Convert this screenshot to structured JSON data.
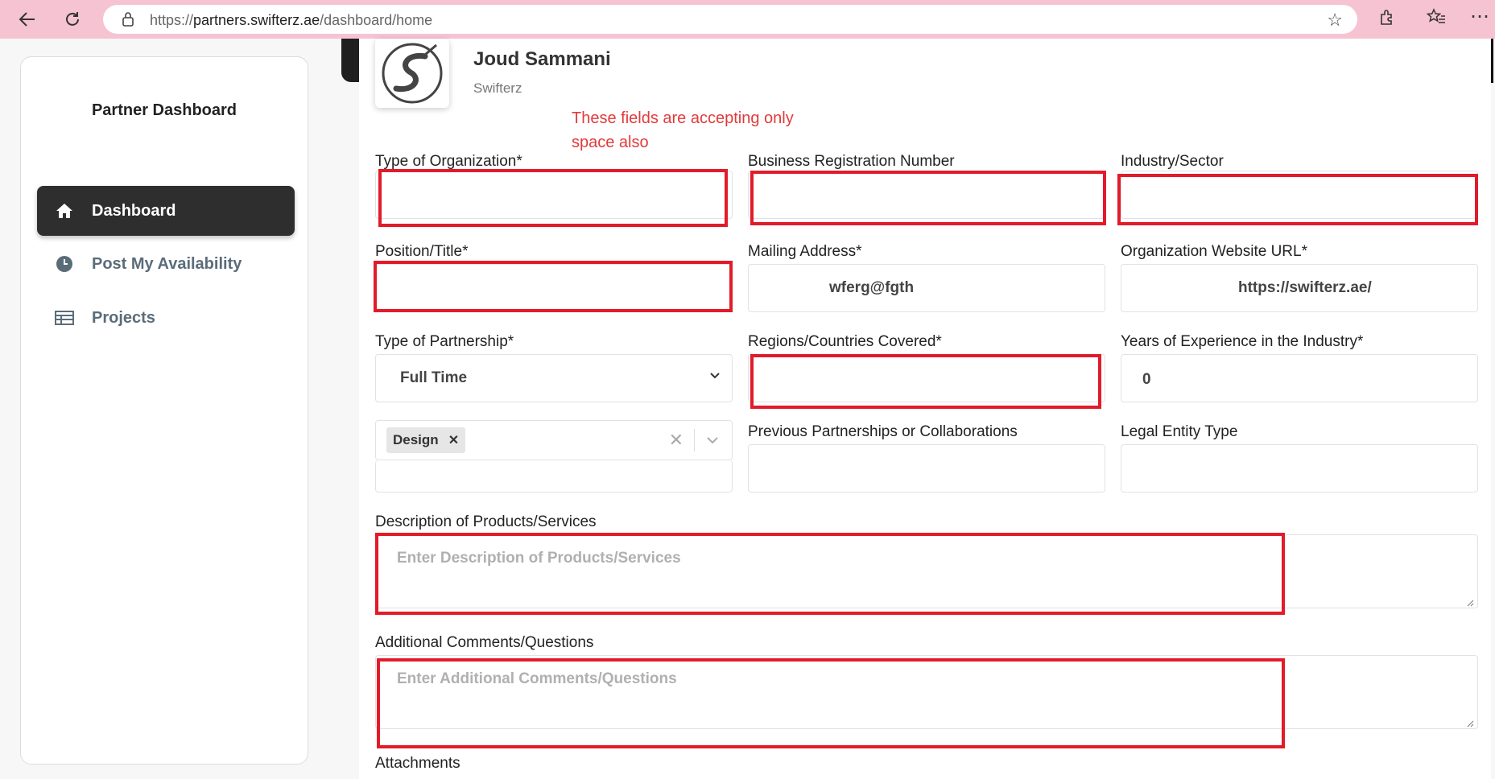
{
  "browser": {
    "url_prefix": "https://",
    "url_host": "partners.swifterz.ae",
    "url_path": "/dashboard/home"
  },
  "sidebar": {
    "title": "Partner Dashboard",
    "items": [
      {
        "label": "Dashboard",
        "icon": "home-icon",
        "active": true
      },
      {
        "label": "Post My Availability",
        "icon": "clock-icon",
        "active": false
      },
      {
        "label": "Projects",
        "icon": "table-icon",
        "active": false
      }
    ]
  },
  "profile": {
    "name": "Joud Sammani",
    "company": "Swifterz"
  },
  "annotation": {
    "text": "These fields are accepting only space also",
    "color": "#e23a3a"
  },
  "form": {
    "type_of_organization": {
      "label": "Type of Organization*",
      "value": ""
    },
    "business_registration_number": {
      "label": "Business Registration Number",
      "value": ""
    },
    "industry_sector": {
      "label": "Industry/Sector",
      "value": ""
    },
    "position_title": {
      "label": "Position/Title*",
      "value": ""
    },
    "mailing_address": {
      "label": "Mailing Address*",
      "value": "wferg@fgth"
    },
    "organization_website_url": {
      "label": "Organization Website URL*",
      "value": "https://swifterz.ae/"
    },
    "type_of_partnership": {
      "label": "Type of Partnership*",
      "value": "Full Time"
    },
    "regions_countries_covered": {
      "label": "Regions/Countries Covered*",
      "value": ""
    },
    "years_of_experience": {
      "label": "Years of Experience in the Industry*",
      "value": "0"
    },
    "skills_multiselect": {
      "chips": [
        "Design"
      ]
    },
    "previous_partnerships": {
      "label": "Previous Partnerships or Collaborations",
      "value": ""
    },
    "legal_entity_type": {
      "label": "Legal Entity Type",
      "value": ""
    },
    "description": {
      "label": "Description of Products/Services",
      "placeholder": "Enter Description of Products/Services"
    },
    "additional_comments": {
      "label": "Additional Comments/Questions",
      "placeholder": "Enter Additional Comments/Questions"
    },
    "attachments": {
      "label": "Attachments"
    }
  },
  "colors": {
    "browser_chrome": "#f6c3d2",
    "highlight_red": "#e21b2a",
    "sidebar_active": "#2e2e2e"
  }
}
